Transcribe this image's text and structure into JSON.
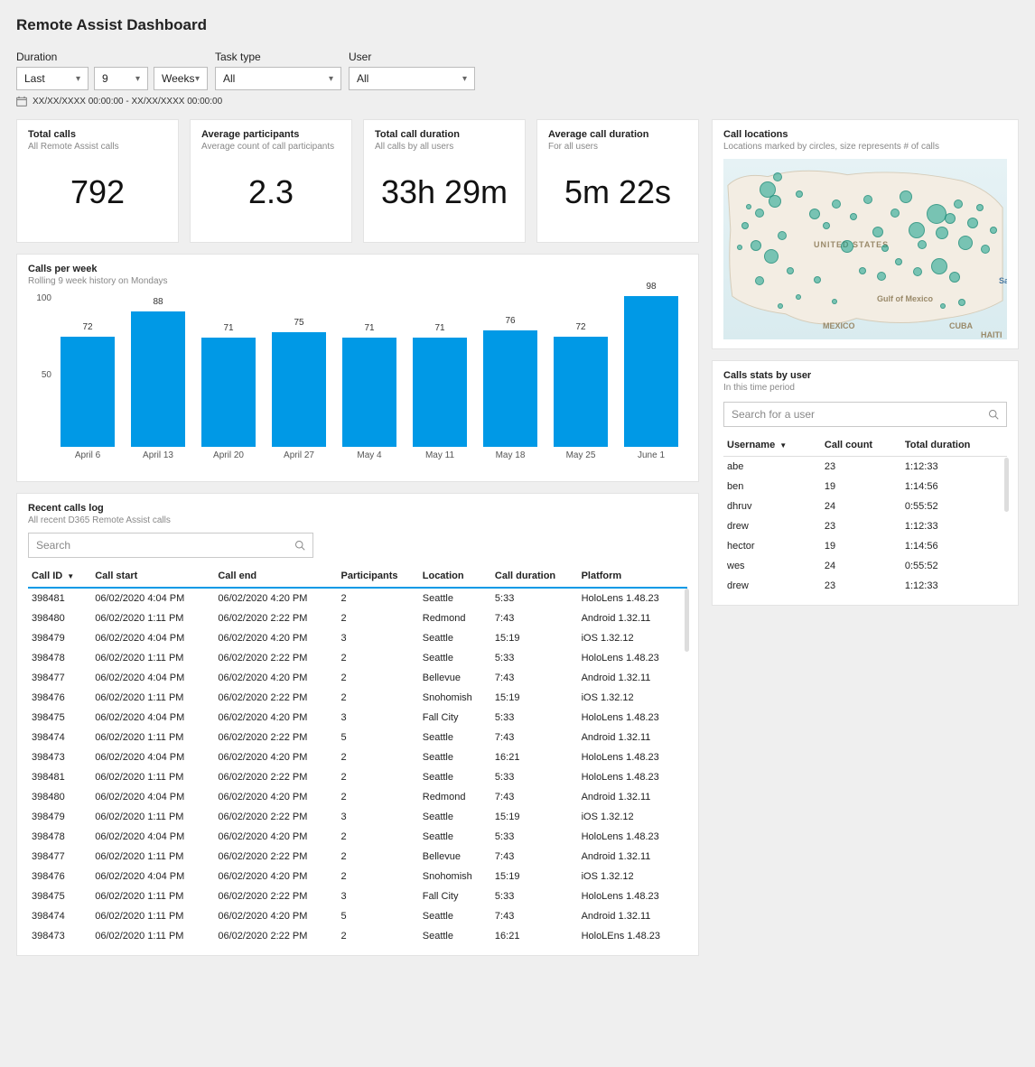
{
  "title": "Remote Assist Dashboard",
  "filters": {
    "duration_label": "Duration",
    "duration_type": "Last",
    "duration_count": "9",
    "duration_unit": "Weeks",
    "task_label": "Task type",
    "task_value": "All",
    "user_label": "User",
    "user_value": "All",
    "date_range": "XX/XX/XXXX 00:00:00 - XX/XX/XXXX 00:00:00"
  },
  "kpis": [
    {
      "title": "Total calls",
      "sub": "All Remote Assist calls",
      "value": "792"
    },
    {
      "title": "Average participants",
      "sub": "Average count of call participants",
      "value": "2.3"
    },
    {
      "title": "Total call duration",
      "sub": "All calls by all users",
      "value": "33h 29m"
    },
    {
      "title": "Average call duration",
      "sub": "For all users",
      "value": "5m 22s"
    }
  ],
  "chart": {
    "title": "Calls per week",
    "sub": "Rolling 9 week history on Mondays"
  },
  "chart_data": {
    "type": "bar",
    "categories": [
      "April 6",
      "April 13",
      "April 20",
      "April 27",
      "May 4",
      "May 11",
      "May 18",
      "May 25",
      "June 1"
    ],
    "values": [
      72,
      88,
      71,
      75,
      71,
      71,
      76,
      72,
      98
    ],
    "title": "Calls per week",
    "xlabel": "",
    "ylabel": "",
    "ylim": [
      0,
      100
    ]
  },
  "log": {
    "title": "Recent calls log",
    "sub": "All recent D365 Remote Assist calls",
    "search_placeholder": "Search",
    "columns": [
      "Call ID",
      "Call start",
      "Call end",
      "Participants",
      "Location",
      "Call duration",
      "Platform"
    ],
    "rows": [
      [
        "398481",
        "06/02/2020 4:04 PM",
        "06/02/2020 4:20 PM",
        "2",
        "Seattle",
        "5:33",
        "HoloLens 1.48.23"
      ],
      [
        "398480",
        "06/02/2020 1:11 PM",
        "06/02/2020 2:22 PM",
        "2",
        "Redmond",
        "7:43",
        "Android 1.32.11"
      ],
      [
        "398479",
        "06/02/2020 4:04 PM",
        "06/02/2020 4:20 PM",
        "3",
        "Seattle",
        "15:19",
        "iOS 1.32.12"
      ],
      [
        "398478",
        "06/02/2020 1:11 PM",
        "06/02/2020 2:22 PM",
        "2",
        "Seattle",
        "5:33",
        "HoloLens 1.48.23"
      ],
      [
        "398477",
        "06/02/2020 4:04 PM",
        "06/02/2020 4:20 PM",
        "2",
        "Bellevue",
        "7:43",
        "Android 1.32.11"
      ],
      [
        "398476",
        "06/02/2020 1:11 PM",
        "06/02/2020 2:22 PM",
        "2",
        "Snohomish",
        "15:19",
        "iOS 1.32.12"
      ],
      [
        "398475",
        "06/02/2020 4:04 PM",
        "06/02/2020 4:20 PM",
        "3",
        "Fall City",
        "5:33",
        "HoloLens 1.48.23"
      ],
      [
        "398474",
        "06/02/2020 1:11 PM",
        "06/02/2020 2:22 PM",
        "5",
        "Seattle",
        "7:43",
        "Android 1.32.11"
      ],
      [
        "398473",
        "06/02/2020 4:04 PM",
        "06/02/2020 4:20 PM",
        "2",
        "Seattle",
        "16:21",
        "HoloLens 1.48.23"
      ],
      [
        "398481",
        "06/02/2020 1:11 PM",
        "06/02/2020 2:22 PM",
        "2",
        "Seattle",
        "5:33",
        "HoloLens 1.48.23"
      ],
      [
        "398480",
        "06/02/2020 4:04 PM",
        "06/02/2020 4:20 PM",
        "2",
        "Redmond",
        "7:43",
        "Android 1.32.11"
      ],
      [
        "398479",
        "06/02/2020 1:11 PM",
        "06/02/2020 2:22 PM",
        "3",
        "Seattle",
        "15:19",
        "iOS 1.32.12"
      ],
      [
        "398478",
        "06/02/2020 4:04 PM",
        "06/02/2020 4:20 PM",
        "2",
        "Seattle",
        "5:33",
        "HoloLens 1.48.23"
      ],
      [
        "398477",
        "06/02/2020 1:11 PM",
        "06/02/2020 2:22 PM",
        "2",
        "Bellevue",
        "7:43",
        "Android 1.32.11"
      ],
      [
        "398476",
        "06/02/2020 4:04 PM",
        "06/02/2020 4:20 PM",
        "2",
        "Snohomish",
        "15:19",
        "iOS 1.32.12"
      ],
      [
        "398475",
        "06/02/2020 1:11 PM",
        "06/02/2020 2:22 PM",
        "3",
        "Fall City",
        "5:33",
        "HoloLens 1.48.23"
      ],
      [
        "398474",
        "06/02/2020 1:11 PM",
        "06/02/2020 4:20 PM",
        "5",
        "Seattle",
        "7:43",
        "Android 1.32.11"
      ],
      [
        "398473",
        "06/02/2020 1:11 PM",
        "06/02/2020 2:22 PM",
        "2",
        "Seattle",
        "16:21",
        "HoloLEns 1.48.23"
      ]
    ]
  },
  "map": {
    "title": "Call locations",
    "sub": "Locations marked by circles, size represents # of calls",
    "labels": {
      "country": "UNITED STATES",
      "gulf": "Gulf of Mexico",
      "mexico": "MEXICO",
      "cuba": "CUBA",
      "haiti": "HAITI",
      "sea": "Sa"
    }
  },
  "stats": {
    "title": "Calls stats by user",
    "sub": "In this time period",
    "search_placeholder": "Search for a user",
    "columns": [
      "Username",
      "Call count",
      "Total duration"
    ],
    "rows": [
      [
        "abe",
        "23",
        "1:12:33"
      ],
      [
        "ben",
        "19",
        "1:14:56"
      ],
      [
        "dhruv",
        "24",
        "0:55:52"
      ],
      [
        "drew",
        "23",
        "1:12:33"
      ],
      [
        "hector",
        "19",
        "1:14:56"
      ],
      [
        "wes",
        "24",
        "0:55:52"
      ],
      [
        "drew",
        "23",
        "1:12:33"
      ]
    ]
  }
}
